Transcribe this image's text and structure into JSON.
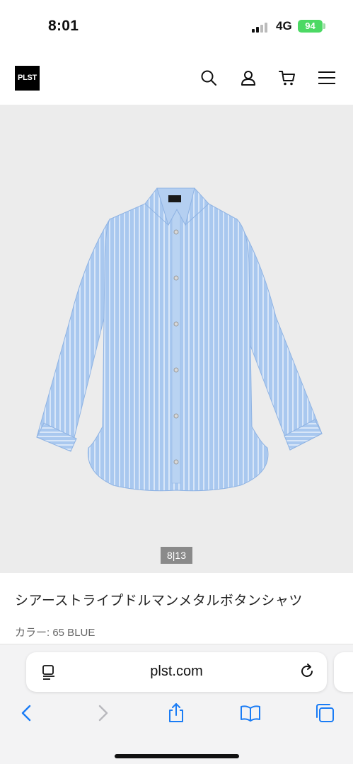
{
  "status_bar": {
    "time": "8:01",
    "network": "4G",
    "battery": "94",
    "battery_color": "#4cd964"
  },
  "header": {
    "logo": "PLST",
    "icons": [
      "search-icon",
      "account-icon",
      "cart-icon",
      "menu-icon"
    ]
  },
  "product": {
    "image_counter": "8|13",
    "title": "シアーストライプドルマンメタルボタンシャツ",
    "color_label": "カラー: 65 BLUE",
    "image_bg": "#ececec",
    "shirt_color": "#a9c8ef"
  },
  "browser": {
    "url": "plst.com",
    "toolbar_icons": [
      "back-icon",
      "forward-icon",
      "share-icon",
      "bookmarks-icon",
      "tabs-icon"
    ],
    "accent": "#1a7cf5"
  }
}
